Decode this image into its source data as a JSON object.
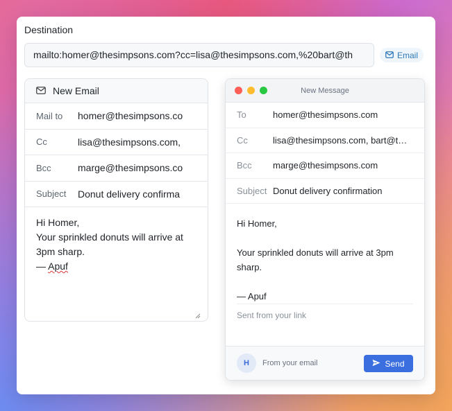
{
  "destination": {
    "label": "Destination",
    "url": "mailto:homer@thesimpsons.com?cc=lisa@thesimpsons.com,%20bart@th",
    "chip_label": "Email",
    "chip_icon": "envelope-icon"
  },
  "form": {
    "title": "New Email",
    "title_icon": "envelope-icon",
    "fields": [
      {
        "label": "Mail to",
        "value": "homer@thesimpsons.co"
      },
      {
        "label": "Cc",
        "value": "lisa@thesimpsons.com,"
      },
      {
        "label": "Bcc",
        "value": "marge@thesimpsons.co"
      },
      {
        "label": "Subject",
        "value": "Donut delivery confirma"
      }
    ],
    "body_lines": [
      "Hi Homer,",
      "",
      "Your sprinkled donuts will arrive at 3pm sharp.",
      ""
    ],
    "signature_dash": "— ",
    "signature_name": "Apuf"
  },
  "preview": {
    "window_title": "New Message",
    "dot_colors": [
      "#ff5f57",
      "#febc2e",
      "#28c840"
    ],
    "fields": [
      {
        "label": "To",
        "value": "homer@thesimpsons.com"
      },
      {
        "label": "Cc",
        "value": "lisa@thesimpsons.com, bart@thesimpsons.com"
      },
      {
        "label": "Bcc",
        "value": "marge@thesimpsons.com"
      },
      {
        "label": "Subject",
        "value": "Donut delivery confirmation"
      }
    ],
    "body": "Hi Homer,\n\nYour sprinkled donuts will arrive at 3pm sharp.\n\n— Apuf",
    "signature": "Sent from your link",
    "avatar_letter": "H",
    "from_label": "From your email",
    "send_label": "Send",
    "send_icon": "paper-plane-icon",
    "accent": "#3b6fe0"
  }
}
